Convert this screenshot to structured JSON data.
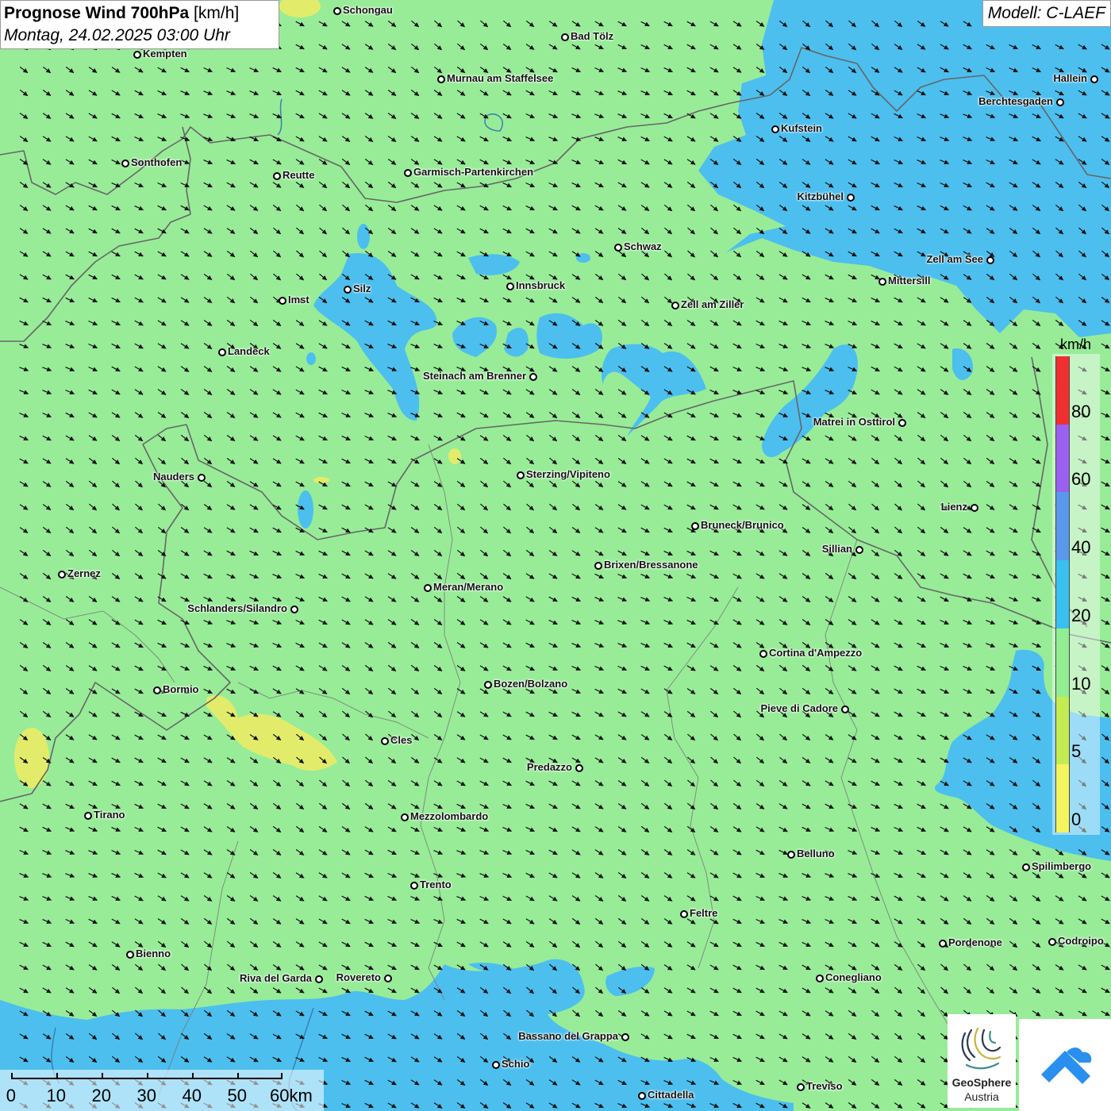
{
  "header": {
    "title_bold": "Prognose Wind 700hPa",
    "title_unit": "[km/h]",
    "datetime": "Montag, 24.02.2025 03:00 Uhr",
    "model": "Modell: C-LAEF"
  },
  "legend": {
    "unit": "km/h",
    "labels": [
      "80",
      "60",
      "40",
      "20",
      "10",
      "5",
      "0"
    ],
    "colors": [
      "#f03030",
      "#9a60ef",
      "#5a98ec",
      "#38c0f0",
      "#92ee92",
      "#c4ec52",
      "#f4f460"
    ]
  },
  "scalebar": {
    "labels": [
      "0",
      "10",
      "20",
      "30",
      "40",
      "50",
      "60km"
    ]
  },
  "logos": {
    "geosphere_line1": "GeoSphere",
    "geosphere_line2": "Austria"
  },
  "colors": {
    "calm_green": "#98ec98",
    "moderate_blue": "#4cbfef",
    "weak_yellow": "#e2ec6a",
    "arrow": "#111111",
    "border": "#555555"
  },
  "cities": [
    {
      "name": "Schongau"
    },
    {
      "name": "Bad Tölz"
    },
    {
      "name": "Kempten"
    },
    {
      "name": "Murnau am Staffelsee"
    },
    {
      "name": "Hallein"
    },
    {
      "name": "Berchtesgaden"
    },
    {
      "name": "Kufstein"
    },
    {
      "name": "Sonthofen"
    },
    {
      "name": "Reutte"
    },
    {
      "name": "Garmisch-Partenkirchen"
    },
    {
      "name": "Kitzbühel"
    },
    {
      "name": "Schwaz"
    },
    {
      "name": "Zell am See"
    },
    {
      "name": "Innsbruck"
    },
    {
      "name": "Silz"
    },
    {
      "name": "Mittersill"
    },
    {
      "name": "Imst"
    },
    {
      "name": "Zell am Ziller"
    },
    {
      "name": "Landeck"
    },
    {
      "name": "Steinach am Brenner"
    },
    {
      "name": "Matrei in Osttirol"
    },
    {
      "name": "Nauders"
    },
    {
      "name": "Sterzing/Vipiteno"
    },
    {
      "name": "Lienz"
    },
    {
      "name": "Bruneck/Brunico"
    },
    {
      "name": "Sillian"
    },
    {
      "name": "Zernez"
    },
    {
      "name": "Brixen/Bressanone"
    },
    {
      "name": "Meran/Merano"
    },
    {
      "name": "Schlanders/Silandro"
    },
    {
      "name": "Cortina d'Ampezzo"
    },
    {
      "name": "Bozen/Bolzano"
    },
    {
      "name": "Bormio"
    },
    {
      "name": "Pieve di Cadore"
    },
    {
      "name": "Cles"
    },
    {
      "name": "Predazzo"
    },
    {
      "name": "Tirano"
    },
    {
      "name": "Mezzolombardo"
    },
    {
      "name": "Belluno"
    },
    {
      "name": "Spilimbergo"
    },
    {
      "name": "Trento"
    },
    {
      "name": "Feltre"
    },
    {
      "name": "Pordenone"
    },
    {
      "name": "Codroipo"
    },
    {
      "name": "Bienno"
    },
    {
      "name": "Riva del Garda"
    },
    {
      "name": "Rovereto"
    },
    {
      "name": "Conegliano"
    },
    {
      "name": "Bassano del Grappa"
    },
    {
      "name": "Schio"
    },
    {
      "name": "Treviso"
    },
    {
      "name": "Cittadella"
    }
  ]
}
